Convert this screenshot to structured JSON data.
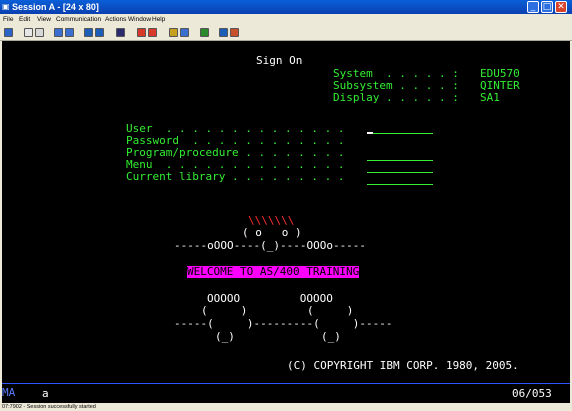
{
  "window": {
    "title": "Session A - [24 x 80]",
    "icon": "emulator-icon",
    "controls": [
      "minimize",
      "maximize",
      "close"
    ]
  },
  "menu": [
    "File",
    "Edit",
    "View",
    "Communication",
    "Actions",
    "Window",
    "Help"
  ],
  "toolbar_icons": [
    "print-screen-icon",
    "copy-icon",
    "paste-icon",
    "send-file-icon",
    "receive-file-icon",
    "display-icon",
    "keyboard-icon",
    "macro-icon",
    "record-icon",
    "play-icon",
    "support-icon",
    "stop-icon",
    "map-icon",
    "help-icon",
    "configure-icon"
  ],
  "signon": {
    "heading": "Sign On",
    "system_label": "System  . . . . . :",
    "system_value": "EDU570",
    "subsystem_label": "Subsystem . . . . :",
    "subsystem_value": "QINTER",
    "display_label": "Display . . . . . :",
    "display_value": "SA1",
    "user_label": "User  . . . . . . . . . . . . . .",
    "password_label": "Password  . . . . . . . . . . . .",
    "program_label": "Program/procedure . . . . . . . .",
    "menu_label": "Menu  . . . . . . . . . . . . . .",
    "library_label": "Current library . . . . . . . . ."
  },
  "art": {
    "hair": "\\\\\\\\\\\\\\",
    "eyes": "( o   o )",
    "face_line": "-----oOOO----(_)----OOOo-----",
    "welcome": "WELCOME TO AS/400 TRAINING",
    "feet_top": "OOOOO         OOOOO",
    "feet_1": "(     )         (     )",
    "feet_2": "-----(     )---------(     )-----",
    "feet_3": "(_)             (_)",
    "copyright": "(C) COPYRIGHT IBM CORP. 1980, 2005."
  },
  "oia": {
    "mode": "MA",
    "indicator": "a",
    "cursor_position": "06/053"
  },
  "status_message": "07:7902 - Session successfully started"
}
